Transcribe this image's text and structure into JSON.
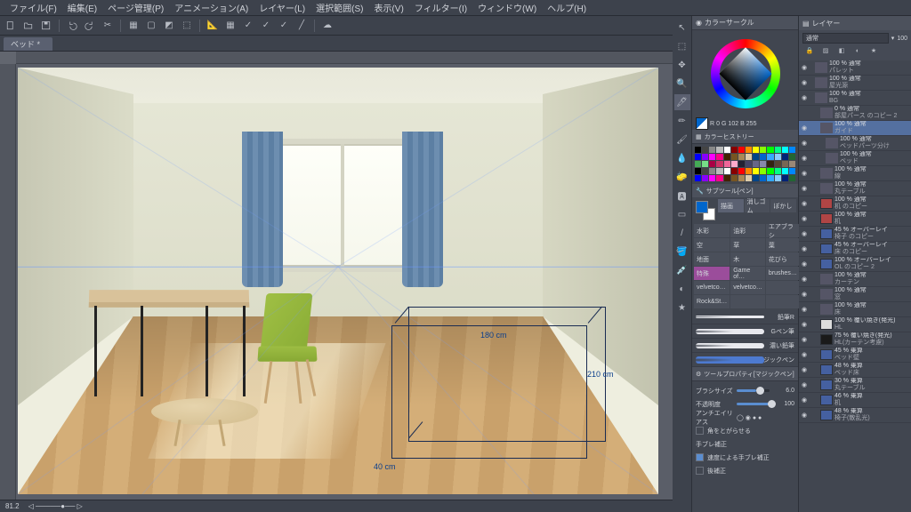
{
  "menu": [
    "ファイル(F)",
    "編集(E)",
    "ページ管理(P)",
    "アニメーション(A)",
    "レイヤー(L)",
    "選択範囲(S)",
    "表示(V)",
    "フィルター(I)",
    "ウィンドウ(W)",
    "ヘルプ(H)"
  ],
  "tab": "ベッド *",
  "rgb": {
    "r": "0",
    "g": "102",
    "b": "255"
  },
  "canvas_dims": {
    "w": "180 cm",
    "h": "210 cm",
    "d": "40 cm"
  },
  "color_history_title": "カラーヒストリー",
  "color_circle_title": "カラーサークル",
  "subtool_title": "サブツール[ペン]",
  "subtool_tabs": [
    "描画",
    "消しゴム",
    "ぼかし"
  ],
  "tools": [
    {
      "l": "水彩"
    },
    {
      "l": "油彩"
    },
    {
      "l": "エアブラシ"
    },
    {
      "l": "空"
    },
    {
      "l": "草"
    },
    {
      "l": "葉"
    },
    {
      "l": "地面"
    },
    {
      "l": "木"
    },
    {
      "l": "花びら"
    },
    {
      "l": "特殊",
      "pnk": 1
    },
    {
      "l": "Game of…"
    },
    {
      "l": "brushes…"
    },
    {
      "l": "velvetco…"
    },
    {
      "l": "velvetco…"
    },
    {
      "l": ""
    },
    {
      "l": "Rock&St…"
    },
    {
      "l": ""
    },
    {
      "l": ""
    }
  ],
  "brushes": [
    "鉛筆R",
    "Gペン筆",
    "濃い鉛筆",
    "マジックペン"
  ],
  "tool_property_title": "ツールプロパティ[マジックペン]",
  "props": {
    "brush_size_label": "ブラシサイズ",
    "brush_size_val": "6.0",
    "opacity_label": "不透明度",
    "opacity_val": "100",
    "aa_label": "アンチエイリアス",
    "round_label": "角をとがらせる",
    "stab_label": "手ブレ補正",
    "speed_label": "速度による手ブレ補正",
    "post_label": "後補正"
  },
  "layer_panel": "レイヤー",
  "blend_mode": "通常",
  "opacity_label_short": "100",
  "layers": [
    {
      "op": "100 % 通常",
      "nm": "パレット",
      "t": "fold"
    },
    {
      "op": "100 % 通常",
      "nm": "屋光源",
      "t": "fold",
      "ico": "fx"
    },
    {
      "op": "100 % 通常",
      "nm": "BG",
      "t": "fold",
      "exp": 1
    },
    {
      "op": "0 % 通常",
      "nm": "部屋パース のコピー 2",
      "t": "fold",
      "d": 1,
      "dis": 1
    },
    {
      "op": "100 % 通常",
      "nm": "ガイド",
      "t": "fold",
      "d": 1,
      "sel": 1
    },
    {
      "op": "100 % 通常",
      "nm": "ベッドパーツ分け",
      "t": "fold",
      "d": 2
    },
    {
      "op": "100 % 通常",
      "nm": "ベッド",
      "t": "fold",
      "d": 2
    },
    {
      "op": "100 % 通常",
      "nm": "線",
      "t": "fold",
      "d": 1
    },
    {
      "op": "100 % 通常",
      "nm": "丸テーブル",
      "t": "fold",
      "d": 1
    },
    {
      "op": "100 % 通常",
      "nm": "机 のコピー",
      "t": "red",
      "d": 1
    },
    {
      "op": "100 % 通常",
      "nm": "机",
      "t": "red",
      "d": 1
    },
    {
      "op": "45 % オーバーレイ",
      "nm": "椅子 のコピー",
      "t": "blu",
      "d": 1
    },
    {
      "op": "45 % オーバーレイ",
      "nm": "床 のコピー",
      "t": "blu",
      "d": 1
    },
    {
      "op": "100 % オーバーレイ",
      "nm": "OL のコピー 2",
      "t": "blu",
      "d": 1
    },
    {
      "op": "100 % 通常",
      "nm": "カーテン",
      "t": "fold",
      "d": 1
    },
    {
      "op": "100 % 通常",
      "nm": "窓",
      "t": "fold",
      "d": 1
    },
    {
      "op": "100 % 通常",
      "nm": "床",
      "t": "fold",
      "d": 1
    },
    {
      "op": "100 % 覆い焼き(発光)",
      "nm": "HL",
      "t": "wht",
      "d": 1
    },
    {
      "op": "75 % 覆い焼き(発光)",
      "nm": "HL(カーテン考慮)",
      "t": "blk",
      "d": 1
    },
    {
      "op": "45 % 乗算",
      "nm": "ベッド壁",
      "t": "blu",
      "d": 1
    },
    {
      "op": "48 % 乗算",
      "nm": "ベッド床",
      "t": "blu",
      "d": 1
    },
    {
      "op": "30 % 乗算",
      "nm": "丸テーブル",
      "t": "blu",
      "d": 1
    },
    {
      "op": "46 % 乗算",
      "nm": "机",
      "t": "blu",
      "d": 1
    },
    {
      "op": "48 % 乗算",
      "nm": "椅子(散乱光)",
      "t": "blu",
      "d": 1
    }
  ],
  "status": {
    "zoom": "81.2",
    "unit": "%"
  }
}
